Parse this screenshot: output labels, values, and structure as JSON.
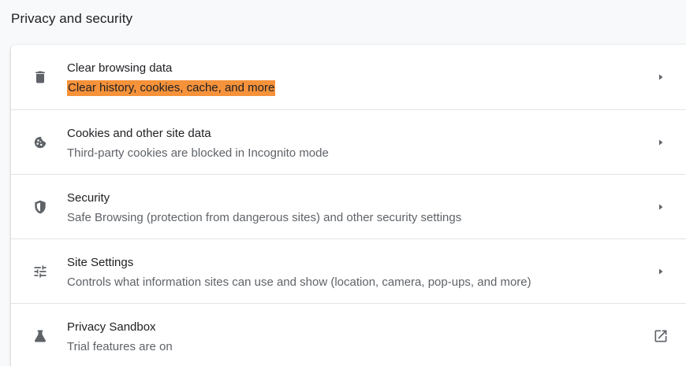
{
  "section": {
    "title": "Privacy and security"
  },
  "items": [
    {
      "label": "Clear browsing data",
      "sublabel": "Clear history, cookies, cache, and more",
      "icon": "trash-icon",
      "action_icon": "arrow-right-icon",
      "highlighted": true
    },
    {
      "label": "Cookies and other site data",
      "sublabel": "Third-party cookies are blocked in Incognito mode",
      "icon": "cookie-icon",
      "action_icon": "arrow-right-icon"
    },
    {
      "label": "Security",
      "sublabel": "Safe Browsing (protection from dangerous sites) and other security settings",
      "icon": "shield-icon",
      "action_icon": "arrow-right-icon"
    },
    {
      "label": "Site Settings",
      "sublabel": "Controls what information sites can use and show (location, camera, pop-ups, and more)",
      "icon": "tune-icon",
      "action_icon": "arrow-right-icon"
    },
    {
      "label": "Privacy Sandbox",
      "sublabel": "Trial features are on",
      "icon": "flask-icon",
      "action_icon": "open-in-new-icon"
    }
  ],
  "colors": {
    "highlight": "#f6923a",
    "icon": "#5f6368",
    "text_primary": "#202124",
    "text_secondary": "#5f6368"
  }
}
